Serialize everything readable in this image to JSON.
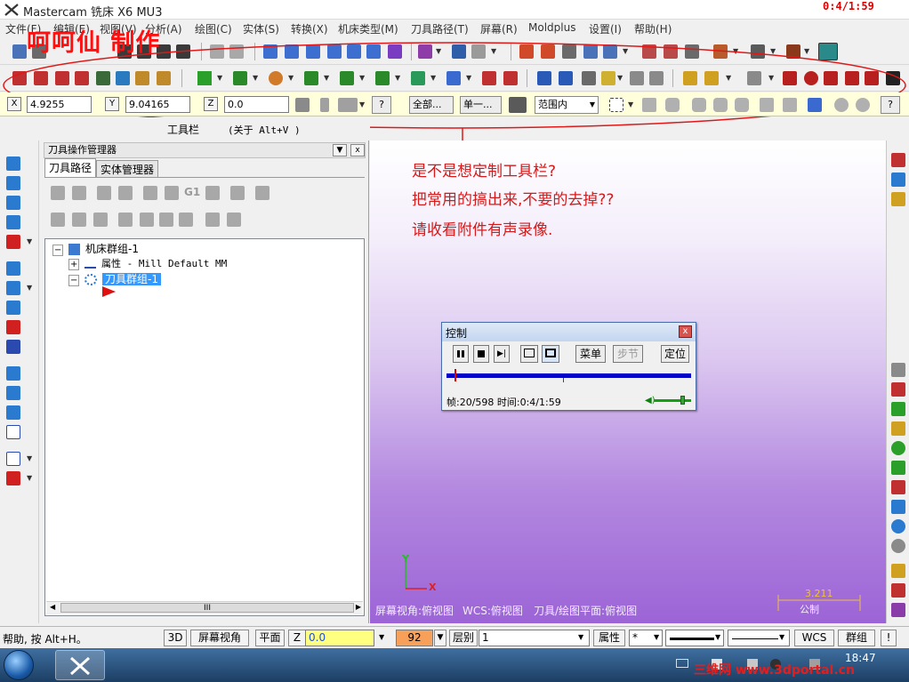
{
  "titlebar": {
    "title": "Mastercam 铣床 X6 MU3",
    "recording_time": "0:4/1:59"
  },
  "overlay": {
    "watermark_title": "呵呵仙 制作"
  },
  "menu": {
    "items": [
      "文件(F)",
      "编辑(E)",
      "视图(V)",
      "分析(A)",
      "绘图(C)",
      "实体(S)",
      "转换(X)",
      "机床类型(M)",
      "刀具路径(T)",
      "屏幕(R)",
      "Moldplus",
      "设置(I)",
      "帮助(H)"
    ]
  },
  "coords": {
    "x_label": "X",
    "x_value": "4.9255",
    "y_label": "Y",
    "y_value": "9.04165",
    "z_label": "Z",
    "z_value": "0.0",
    "all_button": "全部...",
    "single_button": "单一...",
    "range_value": "范围内"
  },
  "toolbar_hint": {
    "label": "工具栏",
    "shortcut": "(关于 Alt+V )"
  },
  "manager": {
    "title": "刀具操作管理器",
    "tabs": [
      "刀具路径",
      "实体管理器"
    ],
    "g1_label": "G1",
    "tree": {
      "machine_group": "机床群组-1",
      "properties": "属性 - Mill Default MM",
      "toolpath_group": "刀具群组-1"
    },
    "scroll_label": "III"
  },
  "graphics": {
    "notes": [
      "是不是想定制工具栏?",
      "把常用的搞出来,不要的去掉??",
      "请收看附件有声录像."
    ],
    "status_screen_view": "屏幕视角:俯视图",
    "status_wcs": "WCS:俯视图",
    "status_tool_plane": "刀具/绘图平面:俯视图",
    "scale_value": "3.211",
    "scale_unit": "公制",
    "axis_x": "X",
    "axis_y": "Y"
  },
  "control_dialog": {
    "title": "控制",
    "close": "x",
    "menu_button": "菜单",
    "step_button": "步节",
    "locate_button": "定位",
    "progress": 0.033,
    "status": "帧:20/598 时间:0:4/1:59"
  },
  "statusbar": {
    "help_text": "帮助, 按 Alt+H。",
    "btn_3d": "3D",
    "btn_screen_view": "屏幕视角",
    "btn_plane": "平面",
    "z_label": "Z",
    "z_value": "0.0",
    "color_value": "92",
    "layer_label": "层别",
    "layer_value": "1",
    "attr_button": "属性",
    "point_style": "*",
    "wcs_button": "WCS",
    "group_button": "群组",
    "exclaim_button": "!"
  },
  "taskbar": {
    "time": "18:47",
    "tray_watermark": "三维网 www.3dportal.cn"
  },
  "colors": {
    "accent_red": "#e00000",
    "note_red": "#d41a1a",
    "track_blue": "#0000c8",
    "z_field_yellow": "#ffff80",
    "color_field_orange": "#f7a05a"
  }
}
